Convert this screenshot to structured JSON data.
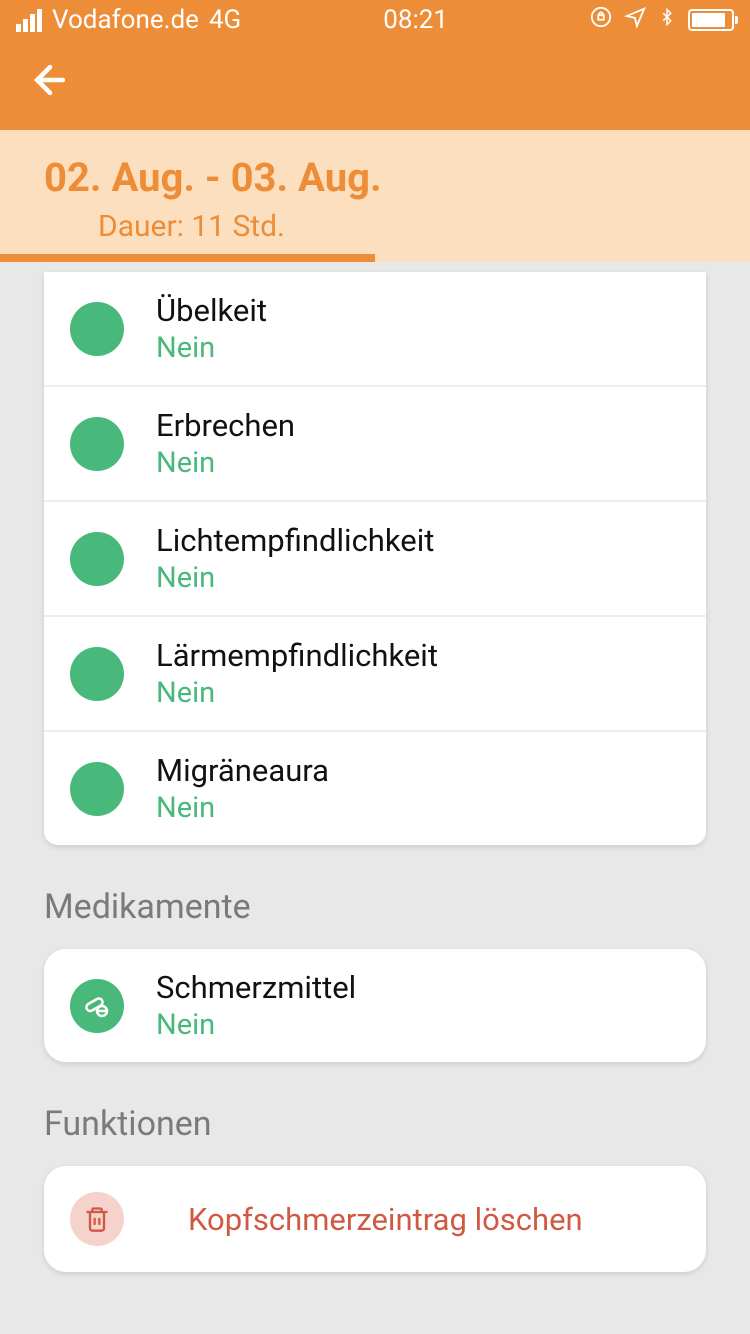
{
  "status": {
    "carrier": "Vodafone.de",
    "network": "4G",
    "time": "08:21"
  },
  "header": {
    "date_range": "02. Aug. - 03. Aug.",
    "duration": "Dauer: 11 Std."
  },
  "symptoms": [
    {
      "label": "Übelkeit",
      "value": "Nein"
    },
    {
      "label": "Erbrechen",
      "value": "Nein"
    },
    {
      "label": "Lichtempfindlichkeit",
      "value": "Nein"
    },
    {
      "label": "Lärmempfindlichkeit",
      "value": "Nein"
    },
    {
      "label": "Migräneaura",
      "value": "Nein"
    }
  ],
  "sections": {
    "medications": "Medikamente",
    "functions": "Funktionen"
  },
  "medications": [
    {
      "label": "Schmerzmittel",
      "value": "Nein"
    }
  ],
  "actions": {
    "delete_label": "Kopfschmerzeintrag löschen"
  }
}
